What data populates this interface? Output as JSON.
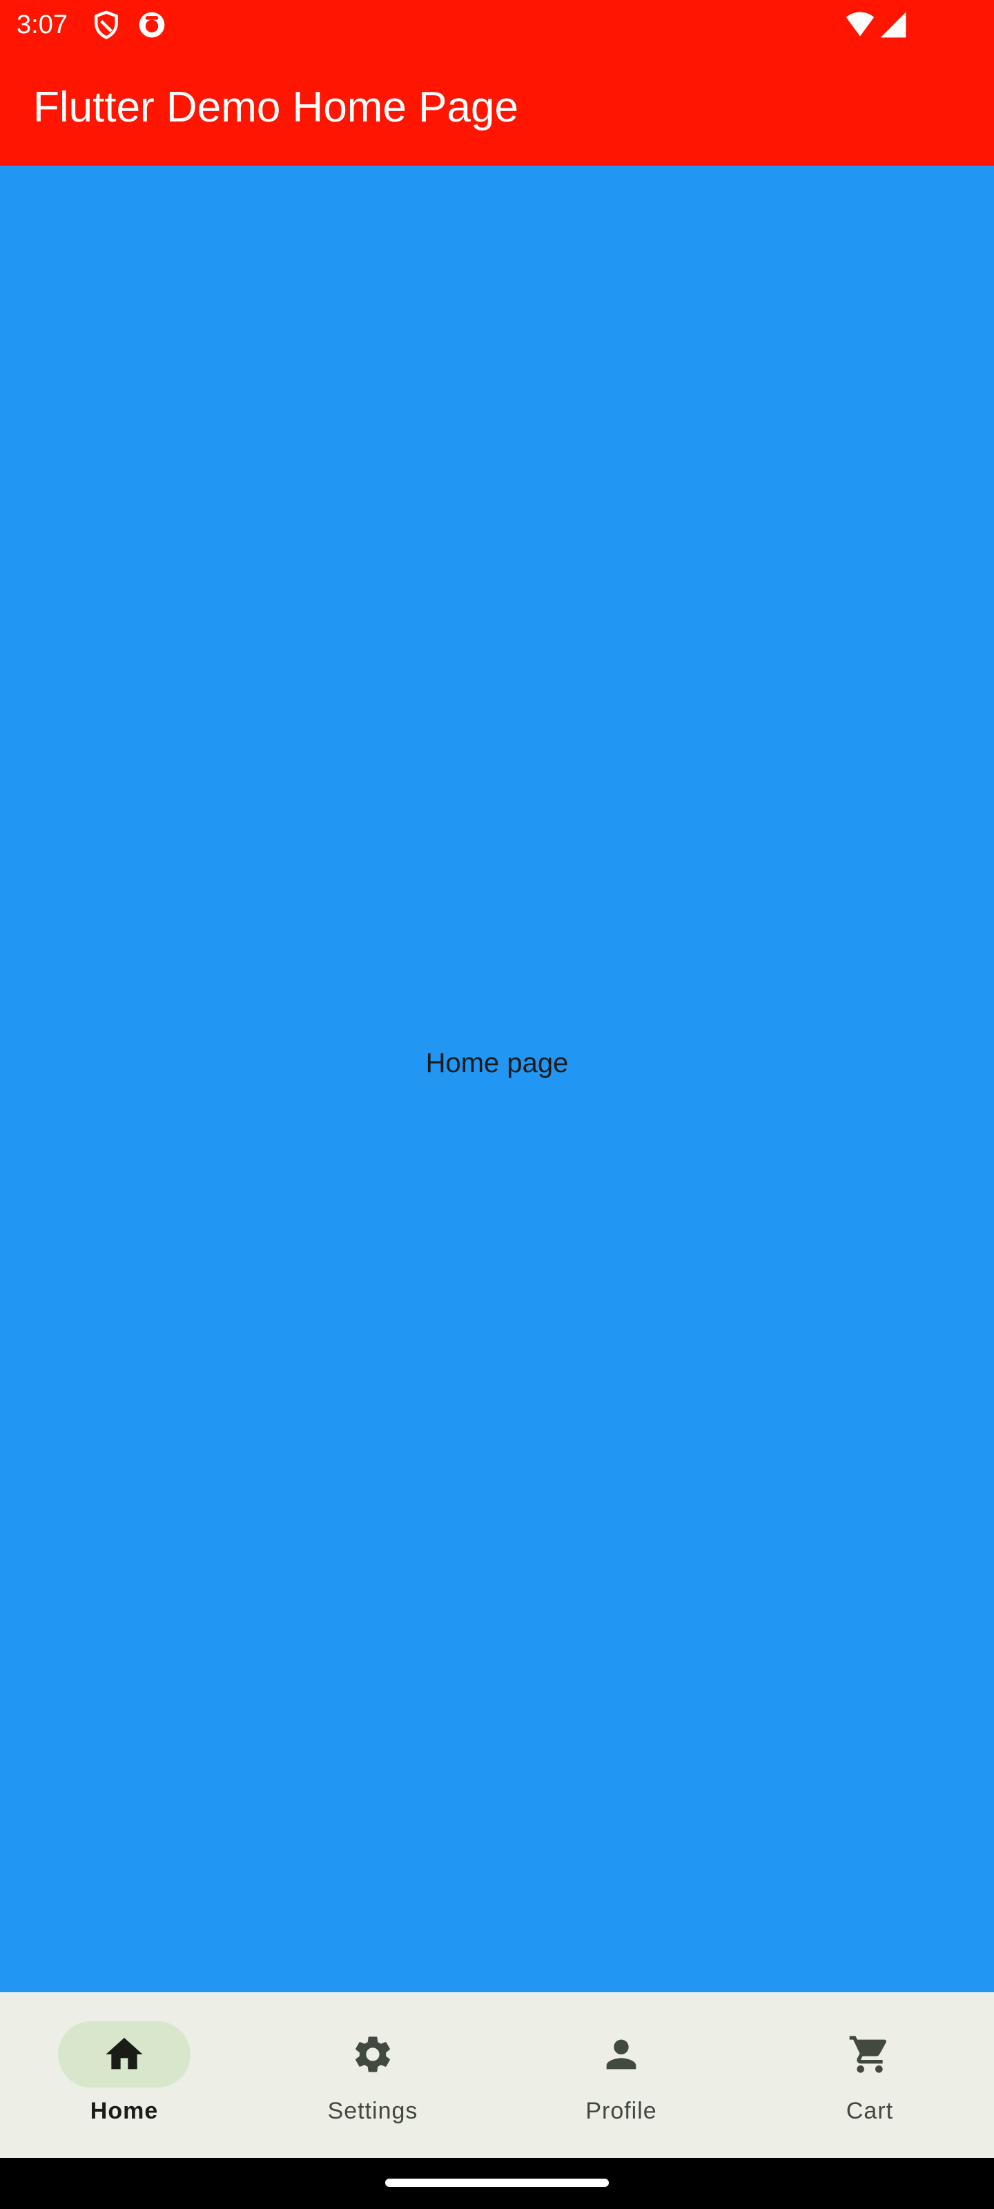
{
  "status_bar": {
    "time": "3:07",
    "icons": [
      "shield-icon",
      "notification-app-icon",
      "wifi-icon",
      "cell-signal-icon"
    ]
  },
  "app_bar": {
    "title": "Flutter Demo Home Page",
    "background_color": "#FF1500"
  },
  "body": {
    "text": "Home page",
    "background_color": "#2196F3"
  },
  "bottom_nav": {
    "items": [
      {
        "label": "Home",
        "icon": "home-icon",
        "selected": true
      },
      {
        "label": "Settings",
        "icon": "gear-icon",
        "selected": false
      },
      {
        "label": "Profile",
        "icon": "person-icon",
        "selected": false
      },
      {
        "label": "Cart",
        "icon": "cart-icon",
        "selected": false
      }
    ],
    "background_color": "#EDEFE7",
    "indicator_color": "#D8E7CB"
  }
}
